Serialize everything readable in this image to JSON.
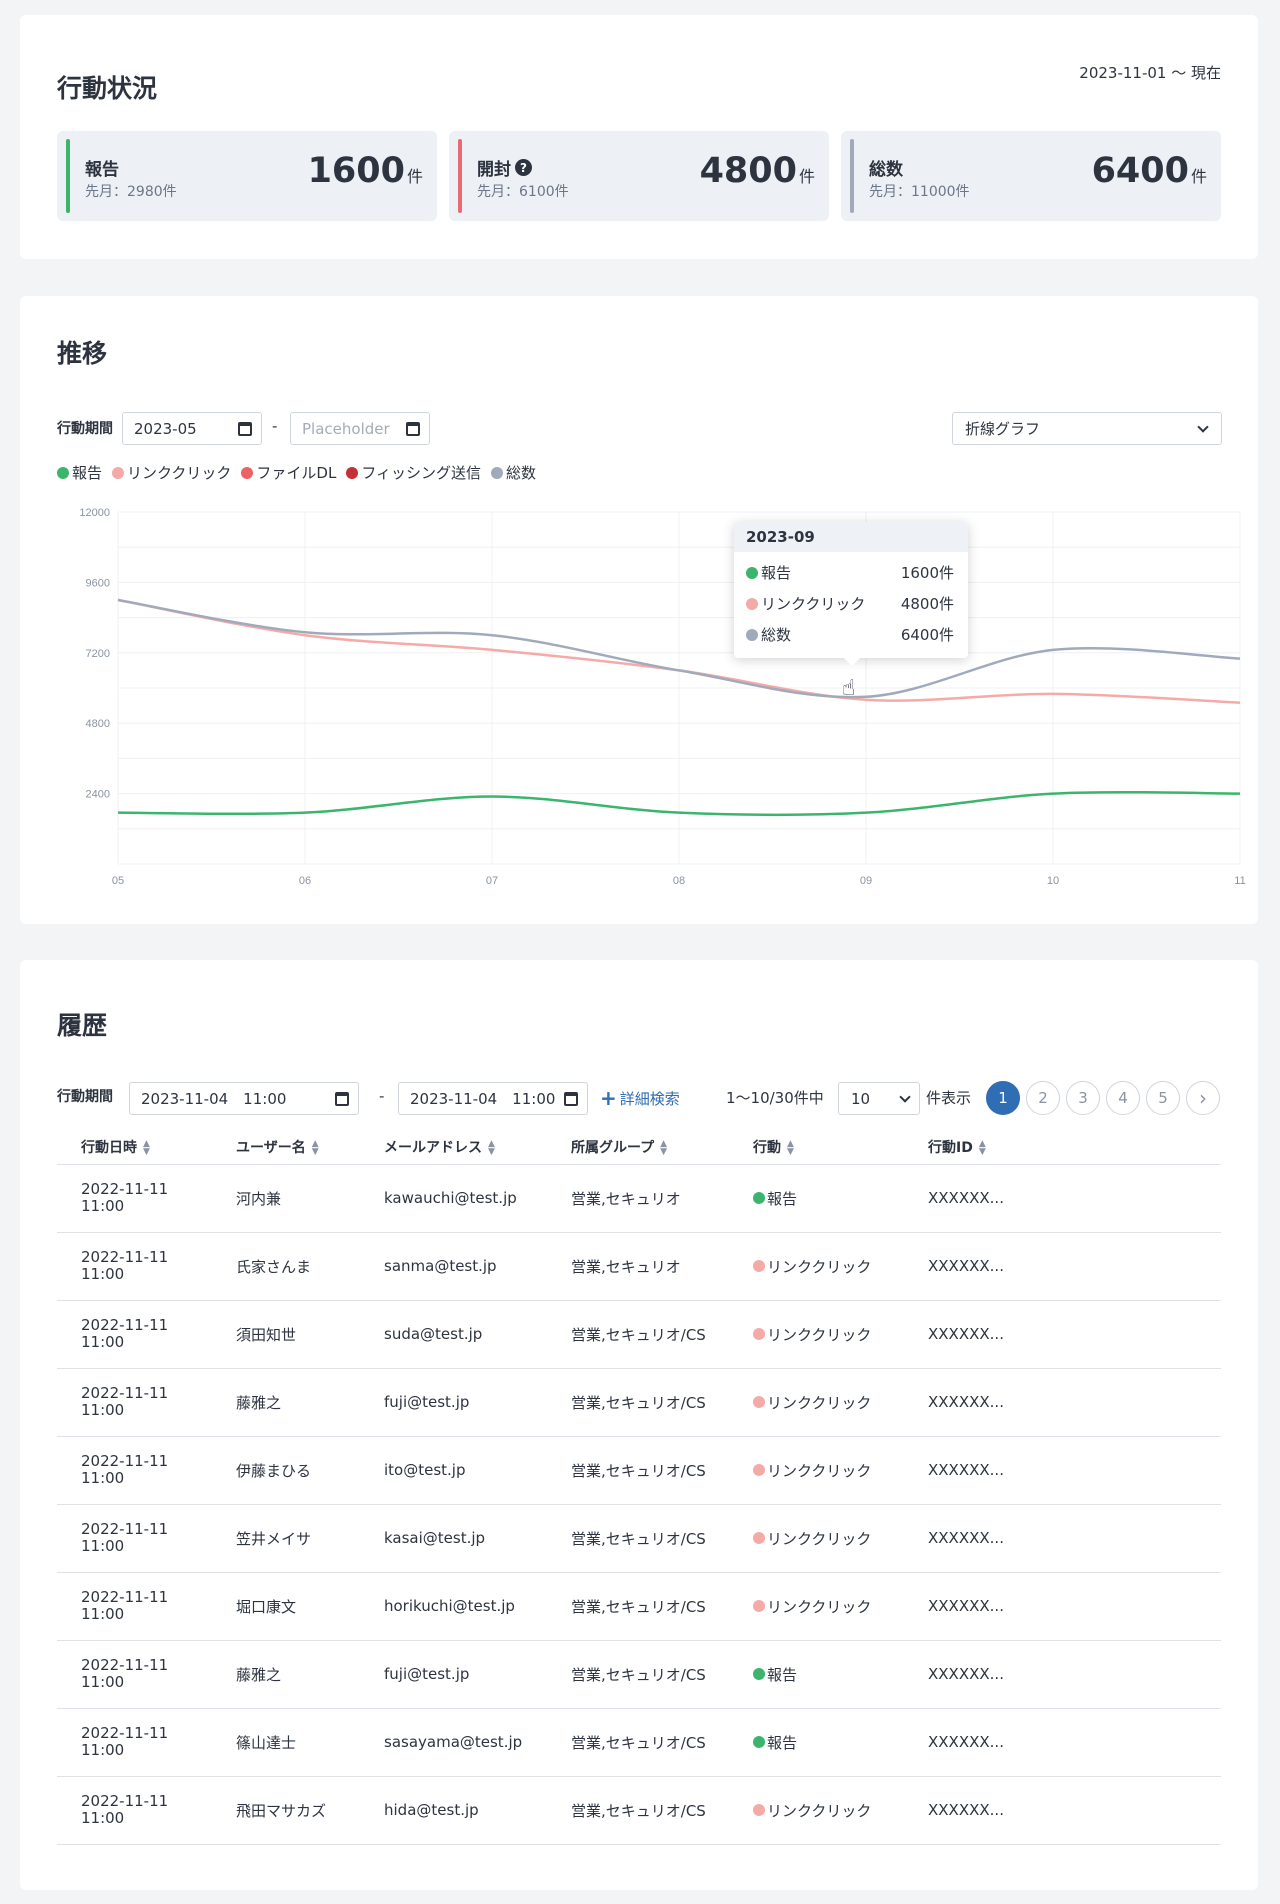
{
  "status": {
    "title": "行動状況",
    "period": "2023-11-01 ～ 現在",
    "stats": [
      {
        "label": "報告",
        "sub": "先月：2980件",
        "value": "1600",
        "unit": "件",
        "color": "#3cb56c"
      },
      {
        "label": "開封",
        "sub": "先月：6100件",
        "value": "4800",
        "unit": "件",
        "color": "#e86a72",
        "help": "?"
      },
      {
        "label": "総数",
        "sub": "先月：11000件",
        "value": "6400",
        "unit": "件",
        "color": "#a0aabb"
      }
    ]
  },
  "trend": {
    "title": "推移",
    "period_label": "行動期間",
    "start_value": "2023-05",
    "end_placeholder": "Placeholder",
    "dash": "-",
    "chart_type_select": "折線グラフ",
    "legend": [
      {
        "name": "報告",
        "color": "#3cb56c"
      },
      {
        "name": "リンククリック",
        "color": "#f5aaa8"
      },
      {
        "name": "ファイルDL",
        "color": "#ec6264"
      },
      {
        "name": "フィッシング送信",
        "color": "#c62f36"
      },
      {
        "name": "総数",
        "color": "#a0aabb"
      }
    ],
    "tooltip": {
      "title": "2023-09",
      "rows": [
        {
          "name": "報告",
          "value": "1600件",
          "color": "#3cb56c"
        },
        {
          "name": "リンククリック",
          "value": "4800件",
          "color": "#f5aaa8"
        },
        {
          "name": "総数",
          "value": "6400件",
          "color": "#a0aabb"
        }
      ]
    }
  },
  "chart_data": {
    "type": "line",
    "categories": [
      "05",
      "06",
      "07",
      "08",
      "09",
      "10",
      "11"
    ],
    "ylim": [
      0,
      12000
    ],
    "yticks": [
      "12000",
      "9600",
      "7200",
      "4800",
      "2400"
    ],
    "grid": true,
    "series": [
      {
        "name": "報告",
        "color": "#3cb56c",
        "values": [
          1750,
          1750,
          2300,
          1750,
          1750,
          2400,
          2400
        ]
      },
      {
        "name": "リンククリック",
        "color": "#f5aaa8",
        "values": [
          9000,
          7800,
          7300,
          6600,
          5600,
          5800,
          5500
        ]
      },
      {
        "name": "総数",
        "color": "#a0aabb",
        "values": [
          9000,
          7900,
          7800,
          6600,
          5700,
          7300,
          7000
        ]
      }
    ]
  },
  "history": {
    "title": "履歴",
    "period_label": "行動期間",
    "start_value": "2023-11-04　11:00",
    "end_value": "2023-11-04　11:00",
    "dash": "-",
    "detail_search": "詳細検索",
    "plus": "+",
    "range_text": "1〜10/30件中",
    "per_page": "10",
    "per_page_suffix": "件表示",
    "pages": [
      "1",
      "2",
      "3",
      "4",
      "5"
    ],
    "next": "›",
    "columns": [
      "行動日時",
      "ユーザー名",
      "メールアドレス",
      "所属グループ",
      "行動",
      "行動ID"
    ],
    "rows": [
      {
        "date": "2022-11-11",
        "time": "11:00",
        "user": "河内兼",
        "email": "kawauchi@test.jp",
        "group": "営業,セキュリオ",
        "action": "報告",
        "action_color": "#3cb56c",
        "id": "XXXXXX..."
      },
      {
        "date": "2022-11-11",
        "time": "11:00",
        "user": "氏家さんま",
        "email": "sanma@test.jp",
        "group": "営業,セキュリオ",
        "action": "リンククリック",
        "action_color": "#f5aaa8",
        "id": "XXXXXX..."
      },
      {
        "date": "2022-11-11",
        "time": "11:00",
        "user": "須田知世",
        "email": "suda@test.jp",
        "group": "営業,セキュリオ/CS",
        "action": "リンククリック",
        "action_color": "#f5aaa8",
        "id": "XXXXXX..."
      },
      {
        "date": "2022-11-11",
        "time": "11:00",
        "user": "藤雅之",
        "email": "fuji@test.jp",
        "group": "営業,セキュリオ/CS",
        "action": "リンククリック",
        "action_color": "#f5aaa8",
        "id": "XXXXXX..."
      },
      {
        "date": "2022-11-11",
        "time": "11:00",
        "user": "伊藤まひる",
        "email": "ito@test.jp",
        "group": "営業,セキュリオ/CS",
        "action": "リンククリック",
        "action_color": "#f5aaa8",
        "id": "XXXXXX..."
      },
      {
        "date": "2022-11-11",
        "time": "11:00",
        "user": "笠井メイサ",
        "email": "kasai@test.jp",
        "group": "営業,セキュリオ/CS",
        "action": "リンククリック",
        "action_color": "#f5aaa8",
        "id": "XXXXXX..."
      },
      {
        "date": "2022-11-11",
        "time": "11:00",
        "user": "堀口康文",
        "email": "horikuchi@test.jp",
        "group": "営業,セキュリオ/CS",
        "action": "リンククリック",
        "action_color": "#f5aaa8",
        "id": "XXXXXX..."
      },
      {
        "date": "2022-11-11",
        "time": "11:00",
        "user": "藤雅之",
        "email": "fuji@test.jp",
        "group": "営業,セキュリオ/CS",
        "action": "報告",
        "action_color": "#3cb56c",
        "id": "XXXXXX..."
      },
      {
        "date": "2022-11-11",
        "time": "11:00",
        "user": "篠山達士",
        "email": "sasayama@test.jp",
        "group": "営業,セキュリオ/CS",
        "action": "報告",
        "action_color": "#3cb56c",
        "id": "XXXXXX..."
      },
      {
        "date": "2022-11-11",
        "time": "11:00",
        "user": "飛田マサカズ",
        "email": "hida@test.jp",
        "group": "営業,セキュリオ/CS",
        "action": "リンククリック",
        "action_color": "#f5aaa8",
        "id": "XXXXXX..."
      }
    ]
  }
}
